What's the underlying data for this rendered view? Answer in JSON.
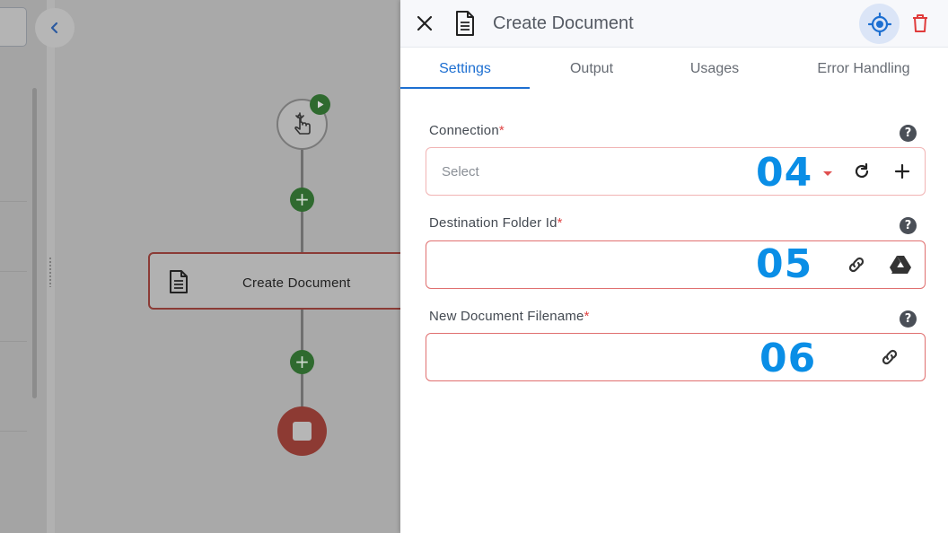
{
  "canvas": {
    "node_label": "Create Document",
    "add_glyph": "+"
  },
  "panel": {
    "title": "Create Document",
    "tabs": [
      {
        "label": "Settings",
        "active": true
      },
      {
        "label": "Output",
        "active": false
      },
      {
        "label": "Usages",
        "active": false
      },
      {
        "label": "Error Handling",
        "active": false
      }
    ]
  },
  "fields": {
    "connection": {
      "label": "Connection",
      "required_mark": "*",
      "placeholder": "Select",
      "step": "04"
    },
    "destination": {
      "label": "Destination Folder Id",
      "required_mark": "*",
      "step": "05"
    },
    "filename": {
      "label": "New Document Filename",
      "required_mark": "*",
      "step": "06"
    }
  },
  "help_glyph": "?",
  "colors": {
    "accent": "#1d6fd1",
    "required": "#e04545",
    "step_number": "#0a8ee6",
    "delete": "#e03b3b",
    "node_border": "#8b3b36"
  },
  "icons": [
    "close-icon",
    "document-icon",
    "locate-icon",
    "trash-icon",
    "refresh-icon",
    "plus-icon",
    "link-icon",
    "google-drive-icon",
    "help-icon",
    "play-icon",
    "tap-icon",
    "stop-icon",
    "chevron-left-icon"
  ]
}
